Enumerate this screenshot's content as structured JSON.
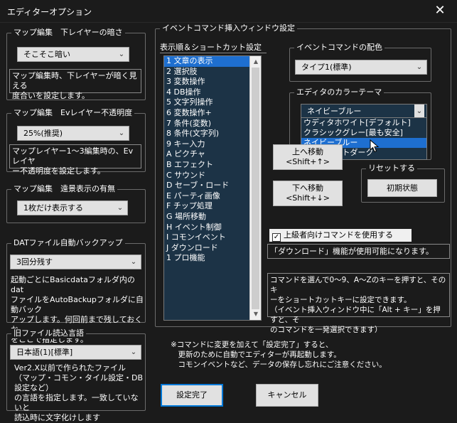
{
  "window": {
    "title": "エディターオプション",
    "close_glyph": "✕"
  },
  "map_lower_darkness": {
    "legend": "マップ編集　下レイヤーの暗さ",
    "value": "そこそこ暗い",
    "description": [
      "マップ編集時、下レイヤーが暗く見える",
      "度合いを設定します。"
    ]
  },
  "map_ev_opacity": {
    "legend": "マップ編集　Evレイヤー不透明度",
    "value": "25%(推奨)",
    "description": [
      "マップレイヤー1～3編集時の、Evレイヤ",
      "ー不透明度を設定します。"
    ]
  },
  "map_distant_view": {
    "legend": "マップ編集　遠景表示の有無",
    "value": "1枚だけ表示する"
  },
  "dat_backup": {
    "legend": "DATファイル自動バックアップ",
    "value": "3回分残す",
    "description": [
      "起動ごとにBasicdataフォルダ内のdat",
      "ファイルをAutoBackupフォルダに自動バック",
      "アップします。何回前まで残しておくか",
      "をここで指定します。"
    ]
  },
  "old_file_language": {
    "legend": "旧ファイル読込言語",
    "value": "日本語(1)[標準]",
    "description": [
      "Ver2.X以前で作られたファイル",
      "（マップ・コモン・タイル設定・DB設定など）",
      "の言語を指定します。一致していないと",
      "読込時に文字化けします"
    ]
  },
  "event_window": {
    "legend": "イベントコマンド挿入ウィンドウ設定",
    "list_label": "表示順＆ショートカット設定",
    "items": [
      "1 文章の表示",
      "2 選択肢",
      "3 変数操作",
      "4 DB操作",
      "5 文字列操作",
      "6 変数操作+",
      "7 条件(変数)",
      "8 条件(文字列)",
      "9 キー入力",
      "A ピクチャ",
      "B エフェクト",
      "C サウンド",
      "D セーブ・ロード",
      "E パーティ画像",
      "F チップ処理",
      "G 場所移動",
      "H イベント制御",
      "I コモンイベント",
      "J ダウンロード",
      "1 プロ機能"
    ],
    "selected_index": 0,
    "move_up_button": [
      "上へ移動",
      "<Shift+↑>"
    ],
    "move_down_button": [
      "下へ移動",
      "<Shift+↓>"
    ],
    "reset_legend": "リセットする",
    "reset_button": "初期状態"
  },
  "command_color": {
    "legend": "イベントコマンドの配色",
    "value": "タイプ1(標準)"
  },
  "editor_theme": {
    "legend": "エディタのカラーテーマ",
    "value": "ネイビーブルー",
    "options": [
      "ウディタホワイト[デフォルト]",
      "クラシックグレー[最も安全]",
      "ネイビーブルー",
      "パーフェクトダーク"
    ],
    "highlighted_index": 2
  },
  "advanced_commands": {
    "label": "上級者向けコマンドを使用する",
    "checked": true,
    "status": "「ダウンロード」機能が使用可能になります。"
  },
  "shortcut_help": [
    "コマンドを選んで0～9、A～Zのキーを押すと、そのキ",
    "ーをショートカットキーに設定できます。",
    "（イベント挿入ウィンドウ中に「Alt + キー」を押すと、そ",
    "のコマンドを一発選択できます）"
  ],
  "footer_note": [
    "※コマンドに変更を加えて「設定完了」すると、",
    "　更新のために自動でエディターが再起動します。",
    "　コモンイベントなど、データの保存し忘れにご注意ください。"
  ],
  "ok_button": "設定完了",
  "cancel_button": "キャンセル",
  "icons": {
    "dropdown": "chevron-down-icon",
    "scroll_up": "triangle-up-icon",
    "scroll_down": "triangle-down-icon"
  }
}
